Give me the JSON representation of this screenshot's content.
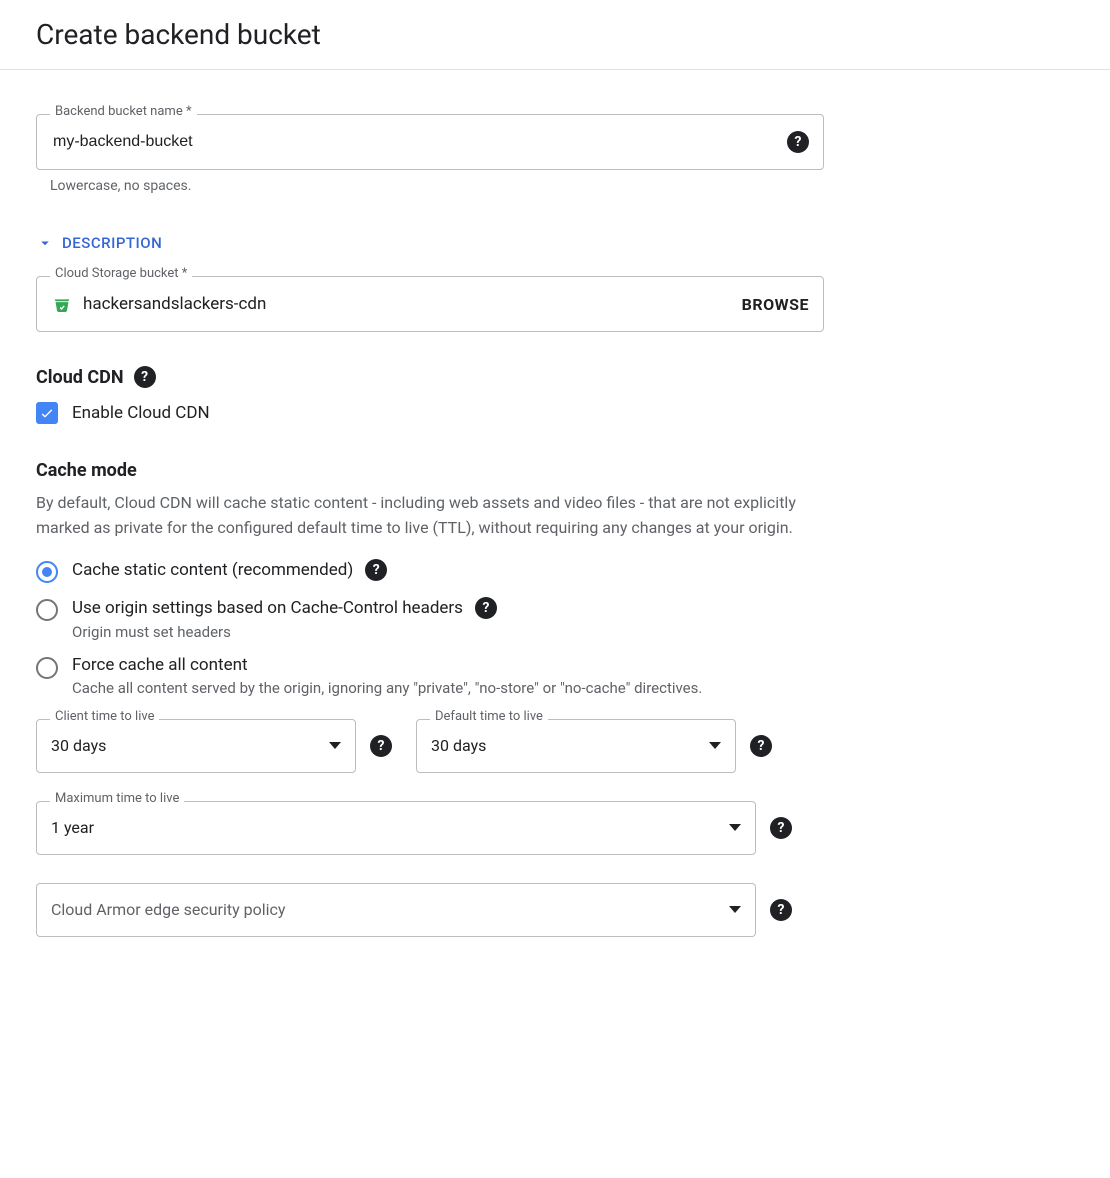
{
  "header": {
    "title": "Create backend bucket"
  },
  "nameField": {
    "label": "Backend bucket name *",
    "value": "my-backend-bucket",
    "helper": "Lowercase, no spaces."
  },
  "descriptionSection": {
    "toggleLabel": "DESCRIPTION"
  },
  "storageBucket": {
    "label": "Cloud Storage bucket *",
    "value": "hackersandslackers-cdn",
    "browseLabel": "BROWSE"
  },
  "cloudCdn": {
    "heading": "Cloud CDN",
    "enableLabel": "Enable Cloud CDN",
    "enabled": true
  },
  "cacheMode": {
    "heading": "Cache mode",
    "description": "By default, Cloud CDN will cache static content - including web assets and video files - that are not explicitly marked as private for the configured default time to live (TTL), without requiring any changes at your origin.",
    "options": [
      {
        "label": "Cache static content (recommended)",
        "sub": "",
        "selected": true,
        "hasHelp": true
      },
      {
        "label": "Use origin settings based on Cache-Control headers",
        "sub": "Origin must set headers",
        "selected": false,
        "hasHelp": true
      },
      {
        "label": "Force cache all content",
        "sub": "Cache all content served by the origin, ignoring any \"private\", \"no-store\" or \"no-cache\" directives.",
        "selected": false,
        "hasHelp": false
      }
    ]
  },
  "ttl": {
    "client": {
      "label": "Client time to live",
      "value": "30 days"
    },
    "default": {
      "label": "Default time to live",
      "value": "30 days"
    },
    "maximum": {
      "label": "Maximum time to live",
      "value": "1 year"
    }
  },
  "armor": {
    "placeholder": "Cloud Armor edge security policy"
  }
}
